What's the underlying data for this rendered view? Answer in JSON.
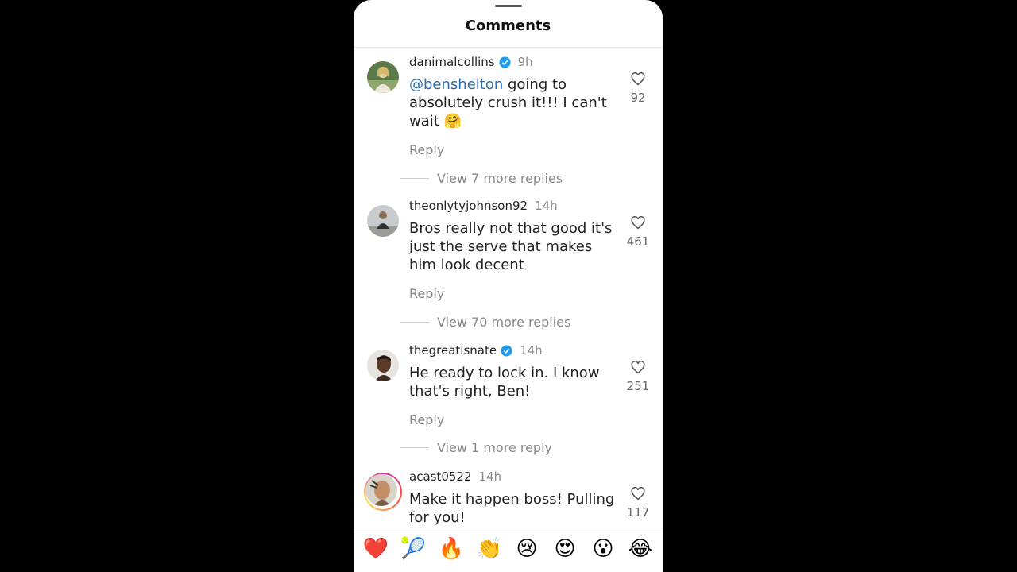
{
  "header": {
    "title": "Comments"
  },
  "comments": [
    {
      "username": "danimalcollins",
      "verified": true,
      "time": "9h",
      "mention": "@benshelton",
      "text": " going to absolutely crush it!!! I can't wait 🤗",
      "likes": "92",
      "reply_label": "Reply",
      "view_more": "View 7 more replies"
    },
    {
      "username": "theonlytyjohnson92",
      "verified": false,
      "time": "14h",
      "text": "Bros really not that good it's just the serve that makes him look decent",
      "likes": "461",
      "reply_label": "Reply",
      "view_more": "View 70 more replies"
    },
    {
      "username": "thegreatisnate",
      "verified": true,
      "time": "14h",
      "text": "He ready to lock in. I know that's right, Ben!",
      "likes": "251",
      "reply_label": "Reply",
      "view_more": "View 1 more reply"
    },
    {
      "username": "acast0522",
      "verified": false,
      "time": "14h",
      "text": "Make it happen boss! Pulling for you!",
      "likes": "117",
      "has_story_ring": true
    }
  ],
  "reactions": [
    "❤️",
    "🎾",
    "🔥",
    "👏",
    "😢",
    "😍",
    "😮",
    "😂"
  ],
  "colors": {
    "mention": "#2b6aa5",
    "verified": "#1d9bf0",
    "background": "#000000"
  },
  "icons": {
    "like": "heart-outline-icon",
    "verified": "verified-badge-icon"
  }
}
